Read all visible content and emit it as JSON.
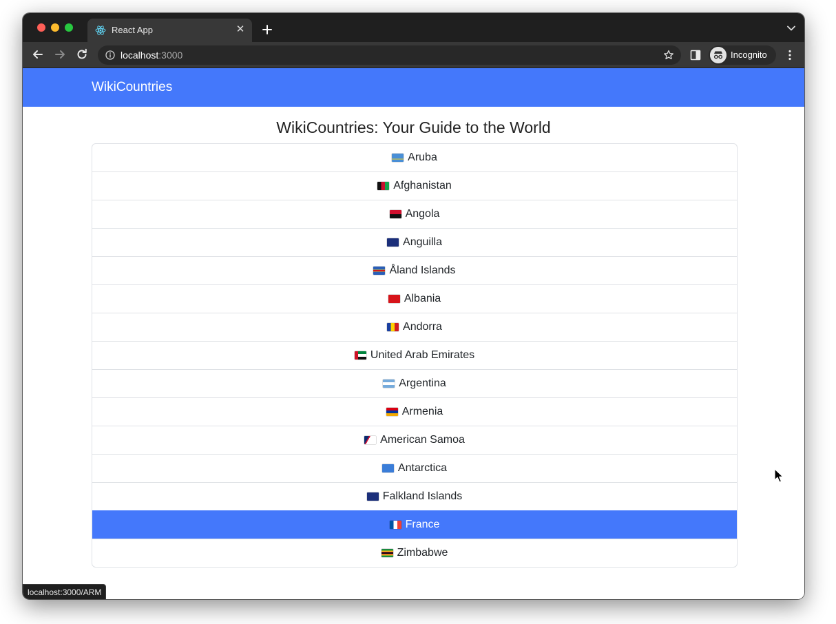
{
  "browser": {
    "tab_title": "React App",
    "url_host": "localhost",
    "url_port": ":3000",
    "profile_label": "Incognito"
  },
  "app": {
    "brand": "WikiCountries",
    "title": "WikiCountries: Your Guide to the World",
    "countries": [
      {
        "name": "Aruba",
        "flag": "aruba-flag-icon"
      },
      {
        "name": "Afghanistan",
        "flag": "afghanistan-flag-icon"
      },
      {
        "name": "Angola",
        "flag": "angola-flag-icon"
      },
      {
        "name": "Anguilla",
        "flag": "anguilla-flag-icon"
      },
      {
        "name": "Åland Islands",
        "flag": "aland-flag-icon"
      },
      {
        "name": "Albania",
        "flag": "albania-flag-icon"
      },
      {
        "name": "Andorra",
        "flag": "andorra-flag-icon"
      },
      {
        "name": "United Arab Emirates",
        "flag": "uae-flag-icon"
      },
      {
        "name": "Argentina",
        "flag": "argentina-flag-icon"
      },
      {
        "name": "Armenia",
        "flag": "armenia-flag-icon"
      },
      {
        "name": "American Samoa",
        "flag": "american-samoa-flag-icon"
      },
      {
        "name": "Antarctica",
        "flag": "antarctica-flag-icon"
      },
      {
        "name": "Falkland Islands",
        "flag": "falkland-flag-icon"
      },
      {
        "name": "France",
        "flag": "france-flag-icon"
      },
      {
        "name": "Zimbabwe",
        "flag": "zimbabwe-flag-icon"
      }
    ],
    "active_country": "France"
  },
  "status_bar": {
    "hover_url": "localhost:3000/ARM"
  },
  "colors": {
    "accent": "#4478fb",
    "tab_strip": "#1f1f1f",
    "toolbar": "#383838"
  }
}
